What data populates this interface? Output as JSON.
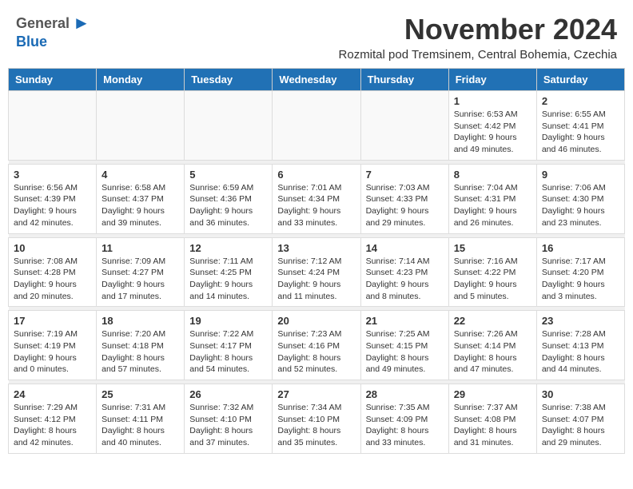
{
  "header": {
    "logo_general": "General",
    "logo_blue": "Blue",
    "month_title": "November 2024",
    "subtitle": "Rozmital pod Tremsinem, Central Bohemia, Czechia"
  },
  "days_of_week": [
    "Sunday",
    "Monday",
    "Tuesday",
    "Wednesday",
    "Thursday",
    "Friday",
    "Saturday"
  ],
  "weeks": [
    [
      {
        "day": "",
        "info": ""
      },
      {
        "day": "",
        "info": ""
      },
      {
        "day": "",
        "info": ""
      },
      {
        "day": "",
        "info": ""
      },
      {
        "day": "",
        "info": ""
      },
      {
        "day": "1",
        "info": "Sunrise: 6:53 AM\nSunset: 4:42 PM\nDaylight: 9 hours and 49 minutes."
      },
      {
        "day": "2",
        "info": "Sunrise: 6:55 AM\nSunset: 4:41 PM\nDaylight: 9 hours and 46 minutes."
      }
    ],
    [
      {
        "day": "3",
        "info": "Sunrise: 6:56 AM\nSunset: 4:39 PM\nDaylight: 9 hours and 42 minutes."
      },
      {
        "day": "4",
        "info": "Sunrise: 6:58 AM\nSunset: 4:37 PM\nDaylight: 9 hours and 39 minutes."
      },
      {
        "day": "5",
        "info": "Sunrise: 6:59 AM\nSunset: 4:36 PM\nDaylight: 9 hours and 36 minutes."
      },
      {
        "day": "6",
        "info": "Sunrise: 7:01 AM\nSunset: 4:34 PM\nDaylight: 9 hours and 33 minutes."
      },
      {
        "day": "7",
        "info": "Sunrise: 7:03 AM\nSunset: 4:33 PM\nDaylight: 9 hours and 29 minutes."
      },
      {
        "day": "8",
        "info": "Sunrise: 7:04 AM\nSunset: 4:31 PM\nDaylight: 9 hours and 26 minutes."
      },
      {
        "day": "9",
        "info": "Sunrise: 7:06 AM\nSunset: 4:30 PM\nDaylight: 9 hours and 23 minutes."
      }
    ],
    [
      {
        "day": "10",
        "info": "Sunrise: 7:08 AM\nSunset: 4:28 PM\nDaylight: 9 hours and 20 minutes."
      },
      {
        "day": "11",
        "info": "Sunrise: 7:09 AM\nSunset: 4:27 PM\nDaylight: 9 hours and 17 minutes."
      },
      {
        "day": "12",
        "info": "Sunrise: 7:11 AM\nSunset: 4:25 PM\nDaylight: 9 hours and 14 minutes."
      },
      {
        "day": "13",
        "info": "Sunrise: 7:12 AM\nSunset: 4:24 PM\nDaylight: 9 hours and 11 minutes."
      },
      {
        "day": "14",
        "info": "Sunrise: 7:14 AM\nSunset: 4:23 PM\nDaylight: 9 hours and 8 minutes."
      },
      {
        "day": "15",
        "info": "Sunrise: 7:16 AM\nSunset: 4:22 PM\nDaylight: 9 hours and 5 minutes."
      },
      {
        "day": "16",
        "info": "Sunrise: 7:17 AM\nSunset: 4:20 PM\nDaylight: 9 hours and 3 minutes."
      }
    ],
    [
      {
        "day": "17",
        "info": "Sunrise: 7:19 AM\nSunset: 4:19 PM\nDaylight: 9 hours and 0 minutes."
      },
      {
        "day": "18",
        "info": "Sunrise: 7:20 AM\nSunset: 4:18 PM\nDaylight: 8 hours and 57 minutes."
      },
      {
        "day": "19",
        "info": "Sunrise: 7:22 AM\nSunset: 4:17 PM\nDaylight: 8 hours and 54 minutes."
      },
      {
        "day": "20",
        "info": "Sunrise: 7:23 AM\nSunset: 4:16 PM\nDaylight: 8 hours and 52 minutes."
      },
      {
        "day": "21",
        "info": "Sunrise: 7:25 AM\nSunset: 4:15 PM\nDaylight: 8 hours and 49 minutes."
      },
      {
        "day": "22",
        "info": "Sunrise: 7:26 AM\nSunset: 4:14 PM\nDaylight: 8 hours and 47 minutes."
      },
      {
        "day": "23",
        "info": "Sunrise: 7:28 AM\nSunset: 4:13 PM\nDaylight: 8 hours and 44 minutes."
      }
    ],
    [
      {
        "day": "24",
        "info": "Sunrise: 7:29 AM\nSunset: 4:12 PM\nDaylight: 8 hours and 42 minutes."
      },
      {
        "day": "25",
        "info": "Sunrise: 7:31 AM\nSunset: 4:11 PM\nDaylight: 8 hours and 40 minutes."
      },
      {
        "day": "26",
        "info": "Sunrise: 7:32 AM\nSunset: 4:10 PM\nDaylight: 8 hours and 37 minutes."
      },
      {
        "day": "27",
        "info": "Sunrise: 7:34 AM\nSunset: 4:10 PM\nDaylight: 8 hours and 35 minutes."
      },
      {
        "day": "28",
        "info": "Sunrise: 7:35 AM\nSunset: 4:09 PM\nDaylight: 8 hours and 33 minutes."
      },
      {
        "day": "29",
        "info": "Sunrise: 7:37 AM\nSunset: 4:08 PM\nDaylight: 8 hours and 31 minutes."
      },
      {
        "day": "30",
        "info": "Sunrise: 7:38 AM\nSunset: 4:07 PM\nDaylight: 8 hours and 29 minutes."
      }
    ]
  ]
}
